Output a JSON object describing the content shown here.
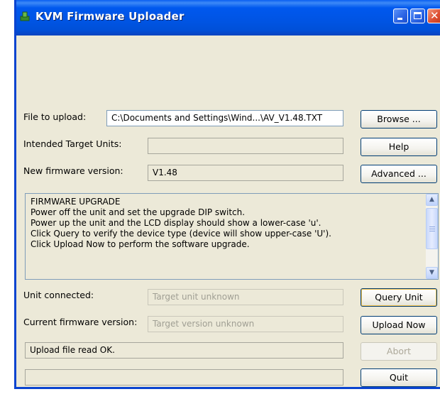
{
  "window": {
    "title": "KVM Firmware Uploader",
    "accent": "#0054e3"
  },
  "form": {
    "file_label": "File to upload:",
    "file_value": "C:\\Documents and Settings\\Wind...\\AV_V1.48.TXT",
    "target_label": "Intended Target Units:",
    "target_value": "",
    "firmware_label": "New firmware version:",
    "firmware_value": "V1.48",
    "unit_label": "Unit connected:",
    "unit_value": "Target unit unknown",
    "current_label": "Current firmware version:",
    "current_value": "Target version unknown",
    "status_value": "Upload file read OK.",
    "progress_percent": 0
  },
  "instructions": [
    "FIRMWARE UPGRADE",
    "Power off the unit and set the upgrade DIP switch.",
    "Power up the unit and the LCD display should show a lower-case 'u'.",
    "Click Query to verify the device type (device will show upper-case 'U').",
    "Click Upload Now to perform the software upgrade."
  ],
  "buttons": {
    "browse": "Browse ...",
    "help": "Help",
    "advanced": "Advanced ...",
    "query": "Query Unit",
    "upload": "Upload Now",
    "abort": "Abort",
    "quit": "Quit"
  },
  "scrollbar": {
    "up_glyph": "▲",
    "down_glyph": "▼"
  },
  "title_buttons": {
    "close_glyph": "✕"
  }
}
